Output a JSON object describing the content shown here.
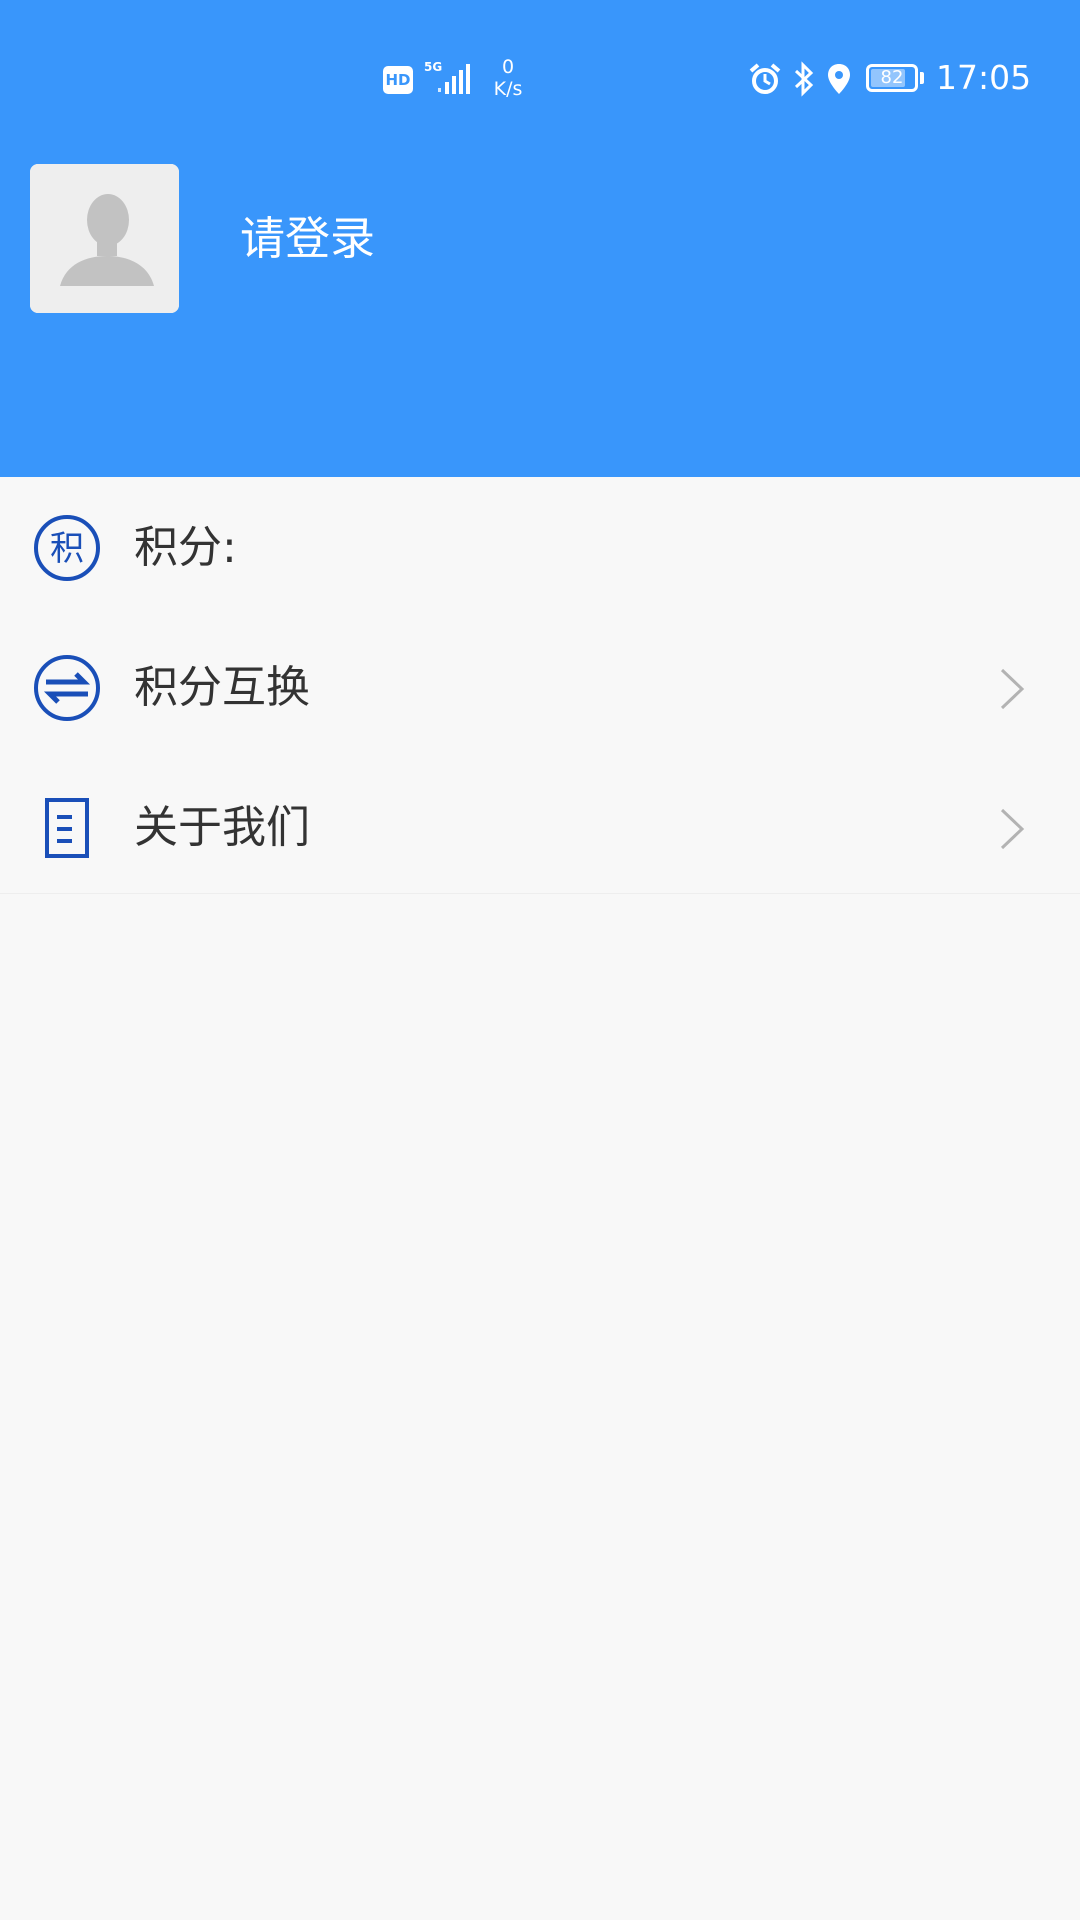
{
  "status_bar": {
    "hd": "HD",
    "network": "5G",
    "speed_value": "0",
    "speed_unit": "K/s",
    "battery_level": "82",
    "time": "17:05"
  },
  "profile": {
    "login_text": "请登录"
  },
  "menu": {
    "items": [
      {
        "label": "积分:",
        "icon": "points-badge-icon",
        "icon_glyph": "积",
        "has_chevron": false
      },
      {
        "label": "积分互换",
        "icon": "exchange-arrows-icon",
        "has_chevron": true
      },
      {
        "label": "关于我们",
        "icon": "document-icon",
        "has_chevron": true
      }
    ]
  },
  "colors": {
    "header_bg": "#3996fb",
    "icon_blue": "#1a4fb8",
    "page_bg": "#f8f8f8",
    "text": "#333333",
    "chevron": "#b3b3b3"
  }
}
